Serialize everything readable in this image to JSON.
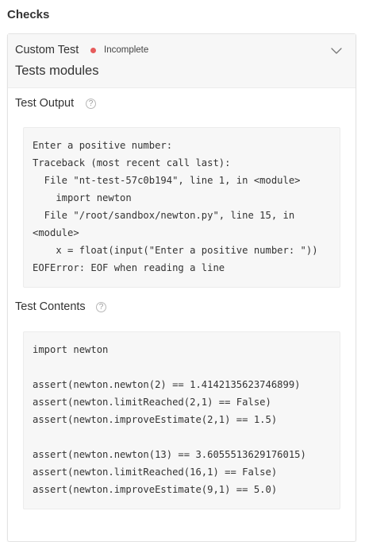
{
  "checks": {
    "heading": "Checks"
  },
  "test": {
    "name": "Custom Test",
    "status": "Incomplete",
    "status_color": "#e65c5c",
    "description": "Tests modules",
    "expand_icon": "chevron-down-icon"
  },
  "output": {
    "title": "Test Output",
    "help_icon": "help-circle-icon",
    "lines": [
      "Enter a positive number:",
      "Traceback (most recent call last):",
      "  File \"nt-test-57c0b194\", line 1, in <module>",
      "    import newton",
      "  File \"/root/sandbox/newton.py\", line 15, in",
      "<module>",
      "    x = float(input(\"Enter a positive number: \"))",
      "EOFError: EOF when reading a line"
    ]
  },
  "contents": {
    "title": "Test Contents",
    "help_icon": "help-circle-icon",
    "lines": [
      "import newton",
      "",
      "assert(newton.newton(2) == 1.4142135623746899)",
      "assert(newton.limitReached(2,1) == False)",
      "assert(newton.improveEstimate(2,1) == 1.5)",
      "",
      "assert(newton.newton(13) == 3.6055513629176015)",
      "assert(newton.limitReached(16,1) == False)",
      "assert(newton.improveEstimate(9,1) == 5.0)"
    ]
  }
}
